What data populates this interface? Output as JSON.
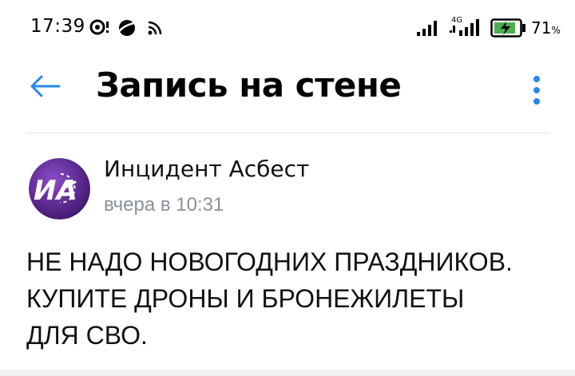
{
  "status_bar": {
    "time": "17:39",
    "network_label": "4G",
    "battery_percent": "71",
    "battery_unit": "%"
  },
  "header": {
    "title": "Запись на стене"
  },
  "post": {
    "author": "Инцидент Асбест",
    "avatar_text": "ИА",
    "posted_time": "вчера в 10:31",
    "text": "НЕ НАДО НОВОГОДНИХ ПРАЗДНИКОВ.\nКУПИТЕ ДРОНЫ И БРОНЕЖИЛЕТЫ\nДЛЯ СВО."
  },
  "colors": {
    "accent": "#2688eb",
    "secondary_text": "#8a9199",
    "avatar_bg": "#5a2a8e"
  },
  "icons": [
    "alarm-icon",
    "planet-icon",
    "rss-icon",
    "signal-icon",
    "battery-charging-icon",
    "back-arrow-icon",
    "more-vertical-icon"
  ]
}
